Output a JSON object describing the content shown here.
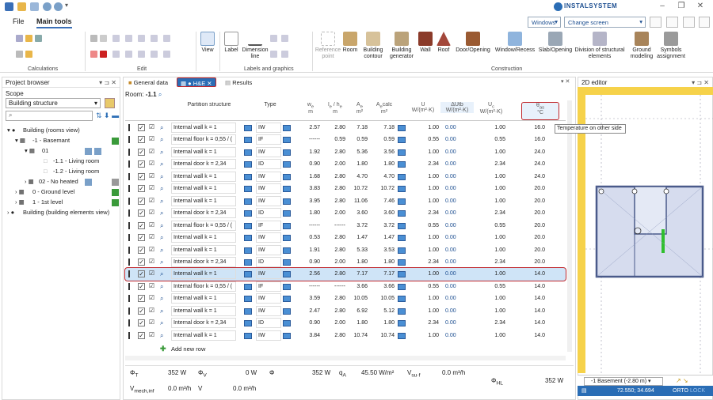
{
  "app": {
    "logo_text": "INSTALSYSTEM"
  },
  "menu": {
    "file": "File",
    "main_tools": "Main tools"
  },
  "toolbar_right": {
    "windows": "Windows",
    "arrangement": "Change screen arrangement"
  },
  "ribbon": {
    "groups": {
      "calculations": "Calculations",
      "edit": "Edit",
      "labels_graphics": "Labels and graphics",
      "construction": "Construction"
    },
    "view": "View",
    "label": "Label",
    "dimension_line": "Dimension line",
    "reference_point": "Reference point",
    "room": "Room",
    "building_contour": "Building contour",
    "building_generator": "Building generator",
    "wall": "Wall",
    "roof": "Roof",
    "door_opening": "Door/Opening",
    "window_recess": "Window/Recess",
    "slab_opening": "Slab/Opening",
    "division": "Division of structural elements",
    "ground_modeling": "Ground modeling",
    "symbols_assignment": "Symbols assignment"
  },
  "project_browser": {
    "title": "Project browser",
    "scope_label": "Scope",
    "scope_value": "Building structure",
    "tree": [
      {
        "label": "Building (rooms view)"
      },
      {
        "label": "-1 - Basemant"
      },
      {
        "label": "01"
      },
      {
        "label": "-1.1 - Living room"
      },
      {
        "label": "-1.2 - Living room"
      },
      {
        "label": "02 - No heated"
      },
      {
        "label": "0 - Ground  level"
      },
      {
        "label": "1 - 1st level"
      },
      {
        "label": "Building (building elements view)"
      }
    ]
  },
  "tabs": {
    "general": "General data",
    "he": "H&E",
    "results": "Results"
  },
  "room": {
    "label": "Room:",
    "value": "-1.1"
  },
  "table": {
    "headers": {
      "partition": "Partition structure",
      "type": "Type",
      "we": "w",
      "we_sub": "e",
      "we_unit": "m",
      "le": "l",
      "le_sub": "e",
      "le_sep": " / h",
      "he_sub": "e",
      "le_unit": "m",
      "a": "A",
      "a_sub": "e",
      "a_unit": "m²",
      "acalc": "A",
      "acalc_sub": "e",
      "acalc_suffix": "calc",
      "acalc_unit": "m²",
      "u": "U",
      "u_unit": "W/(m²·K)",
      "dutb": "ΔUtb",
      "dutb_unit": "W/(m²·K)",
      "uc": "U",
      "uc_sub": "c",
      "uc_unit": "W/(m²·K)",
      "theta": "θ",
      "theta_sub": "as",
      "theta_unit": "°C"
    },
    "tooltip": "Temperature on other side",
    "rows": [
      {
        "name": "Internal wall k = 1",
        "type": "IW",
        "we": "2.57",
        "le": "2.80",
        "a": "7.18",
        "ac": "7.18",
        "u": "1.00",
        "dutb": "0.00",
        "uc": "1.00",
        "t": "16.0"
      },
      {
        "name": "Internal floor k = 0,55 / (",
        "type": "IF",
        "we": "------",
        "le": "0.59",
        "a": "0.59",
        "ac": "0.59",
        "u": "0.55",
        "dutb": "0.00",
        "uc": "0.55",
        "t": "16.0"
      },
      {
        "name": "Internal wall k = 1",
        "type": "IW",
        "we": "1.92",
        "le": "2.80",
        "a": "5.36",
        "ac": "3.56",
        "u": "1.00",
        "dutb": "0.00",
        "uc": "1.00",
        "t": "24.0"
      },
      {
        "name": "Internal door k = 2,34",
        "type": "ID",
        "we": "0.90",
        "le": "2.00",
        "a": "1.80",
        "ac": "1.80",
        "u": "2.34",
        "dutb": "0.00",
        "uc": "2.34",
        "t": "24.0"
      },
      {
        "name": "Internal wall k = 1",
        "type": "IW",
        "we": "1.68",
        "le": "2.80",
        "a": "4.70",
        "ac": "4.70",
        "u": "1.00",
        "dutb": "0.00",
        "uc": "1.00",
        "t": "24.0"
      },
      {
        "name": "Internal wall k = 1",
        "type": "IW",
        "we": "3.83",
        "le": "2.80",
        "a": "10.72",
        "ac": "10.72",
        "u": "1.00",
        "dutb": "0.00",
        "uc": "1.00",
        "t": "20.0"
      },
      {
        "name": "Internal wall k = 1",
        "type": "IW",
        "we": "3.95",
        "le": "2.80",
        "a": "11.06",
        "ac": "7.46",
        "u": "1.00",
        "dutb": "0.00",
        "uc": "1.00",
        "t": "20.0"
      },
      {
        "name": "Internal door k = 2,34",
        "type": "ID",
        "we": "1.80",
        "le": "2.00",
        "a": "3.60",
        "ac": "3.60",
        "u": "2.34",
        "dutb": "0.00",
        "uc": "2.34",
        "t": "20.0"
      },
      {
        "name": "Internal floor k = 0,55 / (",
        "type": "IF",
        "we": "------",
        "le": "------",
        "a": "3.72",
        "ac": "3.72",
        "u": "0.55",
        "dutb": "0.00",
        "uc": "0.55",
        "t": "20.0"
      },
      {
        "name": "Internal wall k = 1",
        "type": "IW",
        "we": "0.53",
        "le": "2.80",
        "a": "1.47",
        "ac": "1.47",
        "u": "1.00",
        "dutb": "0.00",
        "uc": "1.00",
        "t": "20.0"
      },
      {
        "name": "Internal wall k = 1",
        "type": "IW",
        "we": "1.91",
        "le": "2.80",
        "a": "5.33",
        "ac": "3.53",
        "u": "1.00",
        "dutb": "0.00",
        "uc": "1.00",
        "t": "20.0"
      },
      {
        "name": "Internal door k = 2,34",
        "type": "ID",
        "we": "0.90",
        "le": "2.00",
        "a": "1.80",
        "ac": "1.80",
        "u": "2.34",
        "dutb": "0.00",
        "uc": "2.34",
        "t": "20.0"
      },
      {
        "name": "Internal wall k = 1",
        "type": "IW",
        "we": "2.56",
        "le": "2.80",
        "a": "7.17",
        "ac": "7.17",
        "u": "1.00",
        "dutb": "0.00",
        "uc": "1.00",
        "t": "14.0"
      },
      {
        "name": "Internal floor k = 0,55 / (",
        "type": "IF",
        "we": "------",
        "le": "------",
        "a": "3.66",
        "ac": "3.66",
        "u": "0.55",
        "dutb": "0.00",
        "uc": "0.55",
        "t": "14.0"
      },
      {
        "name": "Internal wall k = 1",
        "type": "IW",
        "we": "3.59",
        "le": "2.80",
        "a": "10.05",
        "ac": "10.05",
        "u": "1.00",
        "dutb": "0.00",
        "uc": "1.00",
        "t": "14.0"
      },
      {
        "name": "Internal wall k = 1",
        "type": "IW",
        "we": "2.47",
        "le": "2.80",
        "a": "6.92",
        "ac": "5.12",
        "u": "1.00",
        "dutb": "0.00",
        "uc": "1.00",
        "t": "14.0"
      },
      {
        "name": "Internal door k = 2,34",
        "type": "ID",
        "we": "0.90",
        "le": "2.00",
        "a": "1.80",
        "ac": "1.80",
        "u": "2.34",
        "dutb": "0.00",
        "uc": "2.34",
        "t": "14.0"
      },
      {
        "name": "Internal wall k = 1",
        "type": "IW",
        "we": "3.84",
        "le": "2.80",
        "a": "10.74",
        "ac": "10.74",
        "u": "1.00",
        "dutb": "0.00",
        "uc": "1.00",
        "t": "14.0"
      }
    ],
    "add_row": "Add new row"
  },
  "summary": {
    "phi_t": "Φ",
    "phi_t_sub": "T",
    "phi_t_val": "352 W",
    "phi_v": "Φ",
    "phi_v_sub": "V",
    "phi_v_val": "0 W",
    "phi": "Φ",
    "phi_val": "352 W",
    "qa": "q",
    "qa_sub": "A",
    "qa_val": "45.50 W/m²",
    "vsu": "V",
    "vsu_sub": "su·f",
    "vsu_val": "0.0 m³/h",
    "vmech": "V",
    "vmech_sub": "mech,inf",
    "vmech_val": "0.0 m³/h",
    "v": "V",
    "v_val": "0.0 m³/h",
    "phihl": "Φ",
    "phihl_sub": "HL",
    "phihl_val": "352 W"
  },
  "editor": {
    "title": "2D editor",
    "level": "-1 Basement (-2.80 m)",
    "coords": "72.550; 34.694",
    "mode_orto": "ORTO",
    "mode_lock": "LOCK"
  },
  "colors": {
    "accent": "#1d4f91",
    "highlight_red": "#c0282d",
    "selected_row": "#cfe4f7",
    "status_bar": "#2a6db5"
  }
}
